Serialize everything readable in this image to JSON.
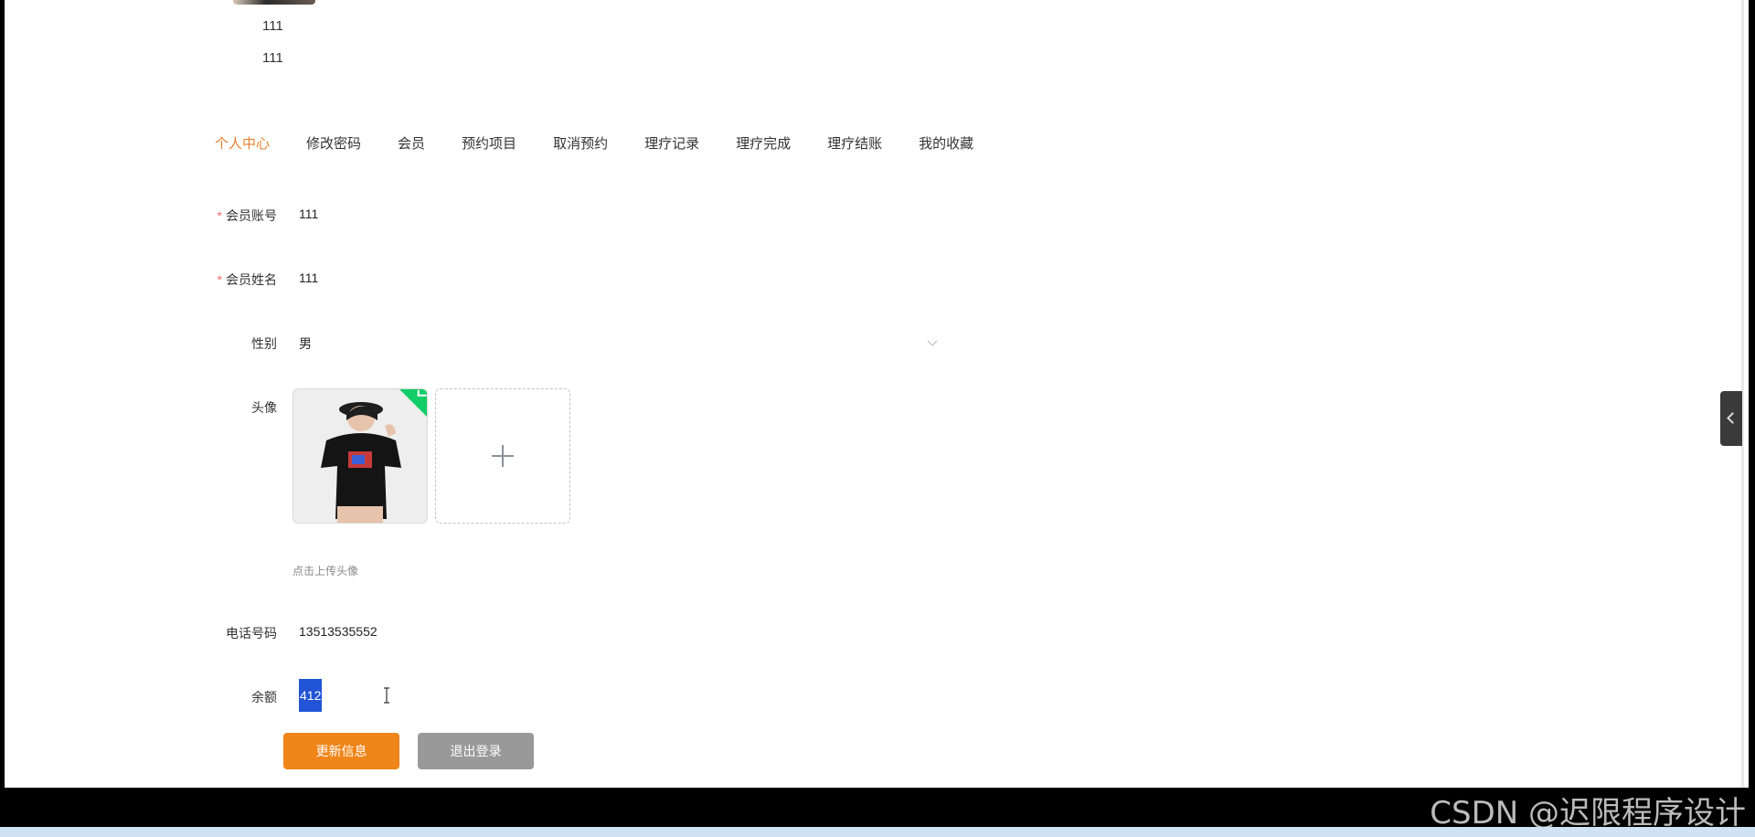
{
  "top": {
    "line1": "111",
    "line2": "111"
  },
  "tabs": [
    {
      "label": "个人中心",
      "active": true
    },
    {
      "label": "修改密码",
      "active": false
    },
    {
      "label": "会员",
      "active": false
    },
    {
      "label": "预约项目",
      "active": false
    },
    {
      "label": "取消预约",
      "active": false
    },
    {
      "label": "理疗记录",
      "active": false
    },
    {
      "label": "理疗完成",
      "active": false
    },
    {
      "label": "理疗结账",
      "active": false
    },
    {
      "label": "我的收藏",
      "active": false
    }
  ],
  "form": {
    "account": {
      "label": "会员账号",
      "required_mark": "*",
      "value": "111"
    },
    "name": {
      "label": "会员姓名",
      "required_mark": "*",
      "value": "111"
    },
    "gender": {
      "label": "性别",
      "value": "男"
    },
    "avatar": {
      "label": "头像",
      "upload_tip": "点击上传头像"
    },
    "phone": {
      "label": "电话号码",
      "value": "13513535552"
    },
    "balance": {
      "label": "余额",
      "value": "412"
    }
  },
  "buttons": {
    "update": "更新信息",
    "logout": "退出登录"
  },
  "watermark": "CSDN @迟限程序设计",
  "colors": {
    "accent": "#e8802c",
    "update_button": "#f08519",
    "logout_button": "#999999",
    "required": "#f56c6c",
    "success": "#13ce66"
  }
}
